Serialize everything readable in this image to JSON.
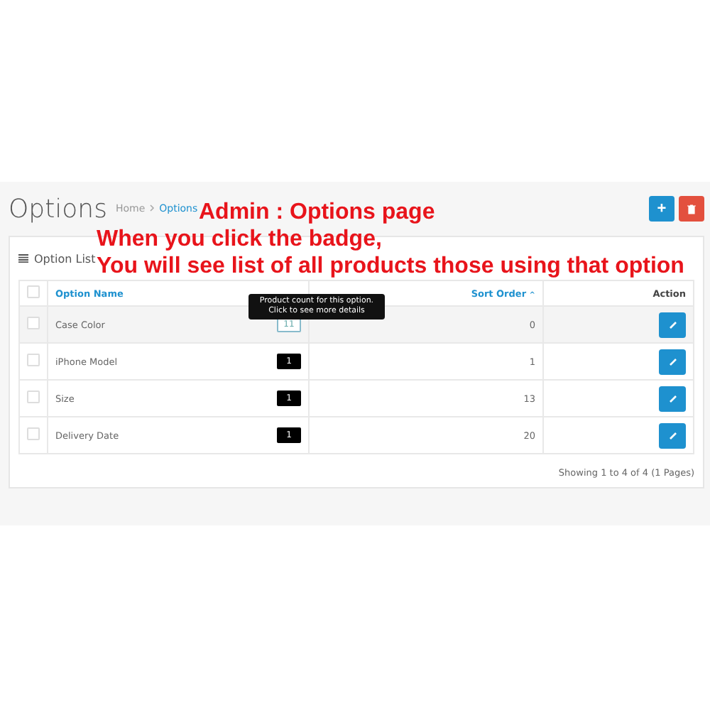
{
  "page": {
    "title": "Options",
    "breadcrumb": [
      {
        "label": "Home",
        "selected": false
      },
      {
        "label": "Options",
        "selected": true
      }
    ],
    "buttons": [
      {
        "kind": "add",
        "label": "+"
      },
      {
        "kind": "delete"
      }
    ]
  },
  "panel": {
    "title": "Option List",
    "table": {
      "select_all_checked": false,
      "columns": [
        {
          "kind": "link",
          "label": "Option Name"
        },
        {
          "kind": "link",
          "label": "Sort Order",
          "sort_arrow": "^"
        },
        {
          "kind": "plain",
          "label": "Action"
        }
      ],
      "rows": [
        {
          "name": "Case Color",
          "count": "11",
          "sort_order": "0",
          "hovered": true,
          "checked": false
        },
        {
          "name": "iPhone Model",
          "count": "1",
          "sort_order": "1",
          "hovered": false,
          "checked": false
        },
        {
          "name": "Size",
          "count": "1",
          "sort_order": "13",
          "hovered": false,
          "checked": false
        },
        {
          "name": "Delivery Date",
          "count": "1",
          "sort_order": "20",
          "hovered": false,
          "checked": false
        }
      ]
    },
    "tooltip": "Product count for this option. Click to see more details",
    "pagination": "Showing 1 to 4 of 4 (1 Pages)"
  },
  "annotations": [
    "Admin : Options page",
    "When you click the badge,",
    "You will see list of all products those using that option"
  ]
}
